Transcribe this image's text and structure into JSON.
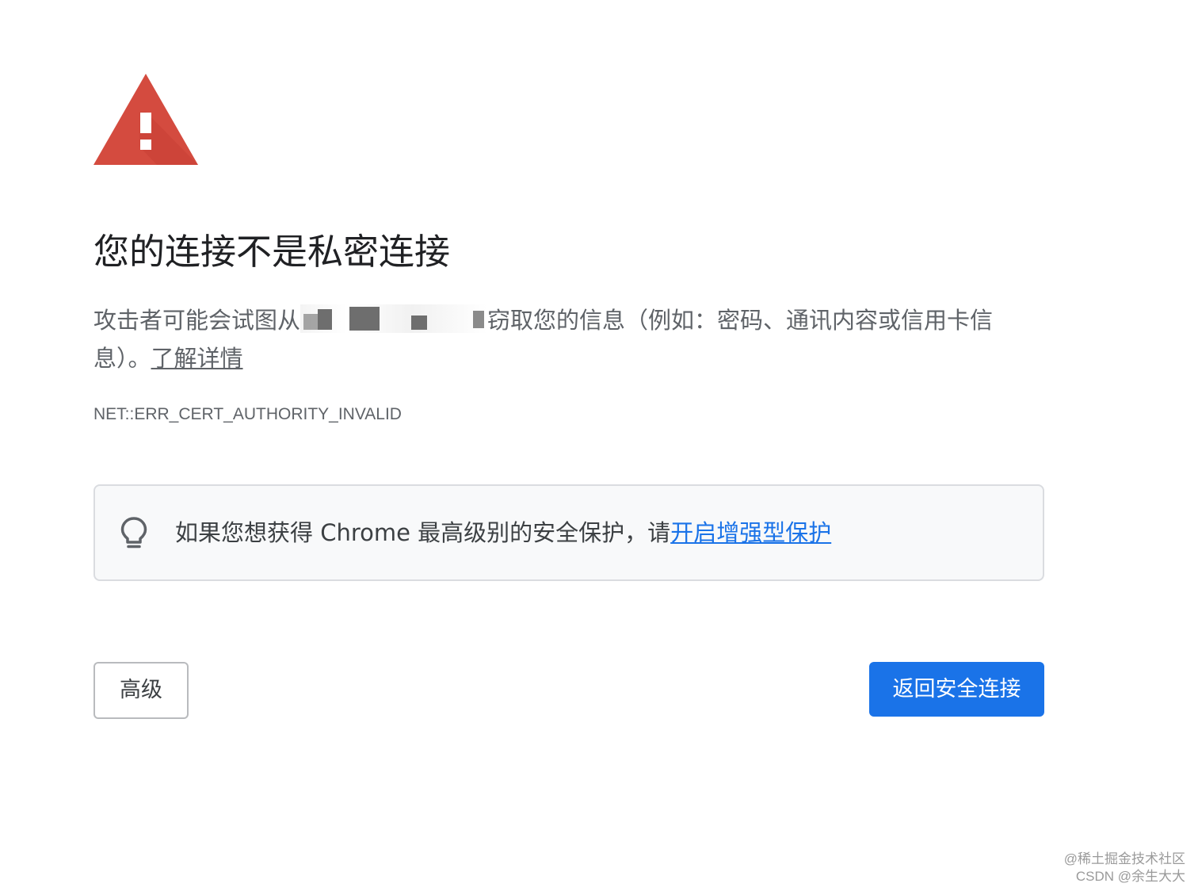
{
  "icons": {
    "warning": "warning-triangle-icon",
    "tip": "lightbulb-icon"
  },
  "colors": {
    "warning_red": "#d44b3f",
    "link_blue": "#1a73e8",
    "primary_button": "#1a73e8"
  },
  "interstitial": {
    "heading": "您的连接不是私密连接",
    "description_before": "攻击者可能会试图从",
    "description_after": "窃取您的信息（例如：密码、通讯内容或信用卡信息）。",
    "learn_more_link": "了解详情",
    "error_code": "NET::ERR_CERT_AUTHORITY_INVALID"
  },
  "tip": {
    "text": "如果您想获得 Chrome 最高级别的安全保护，请",
    "link": "开启增强型保护"
  },
  "buttons": {
    "advanced": "高级",
    "back_to_safety": "返回安全连接"
  },
  "watermark": {
    "line1": "@稀土掘金技术社区",
    "line2": "CSDN @余生大大"
  }
}
